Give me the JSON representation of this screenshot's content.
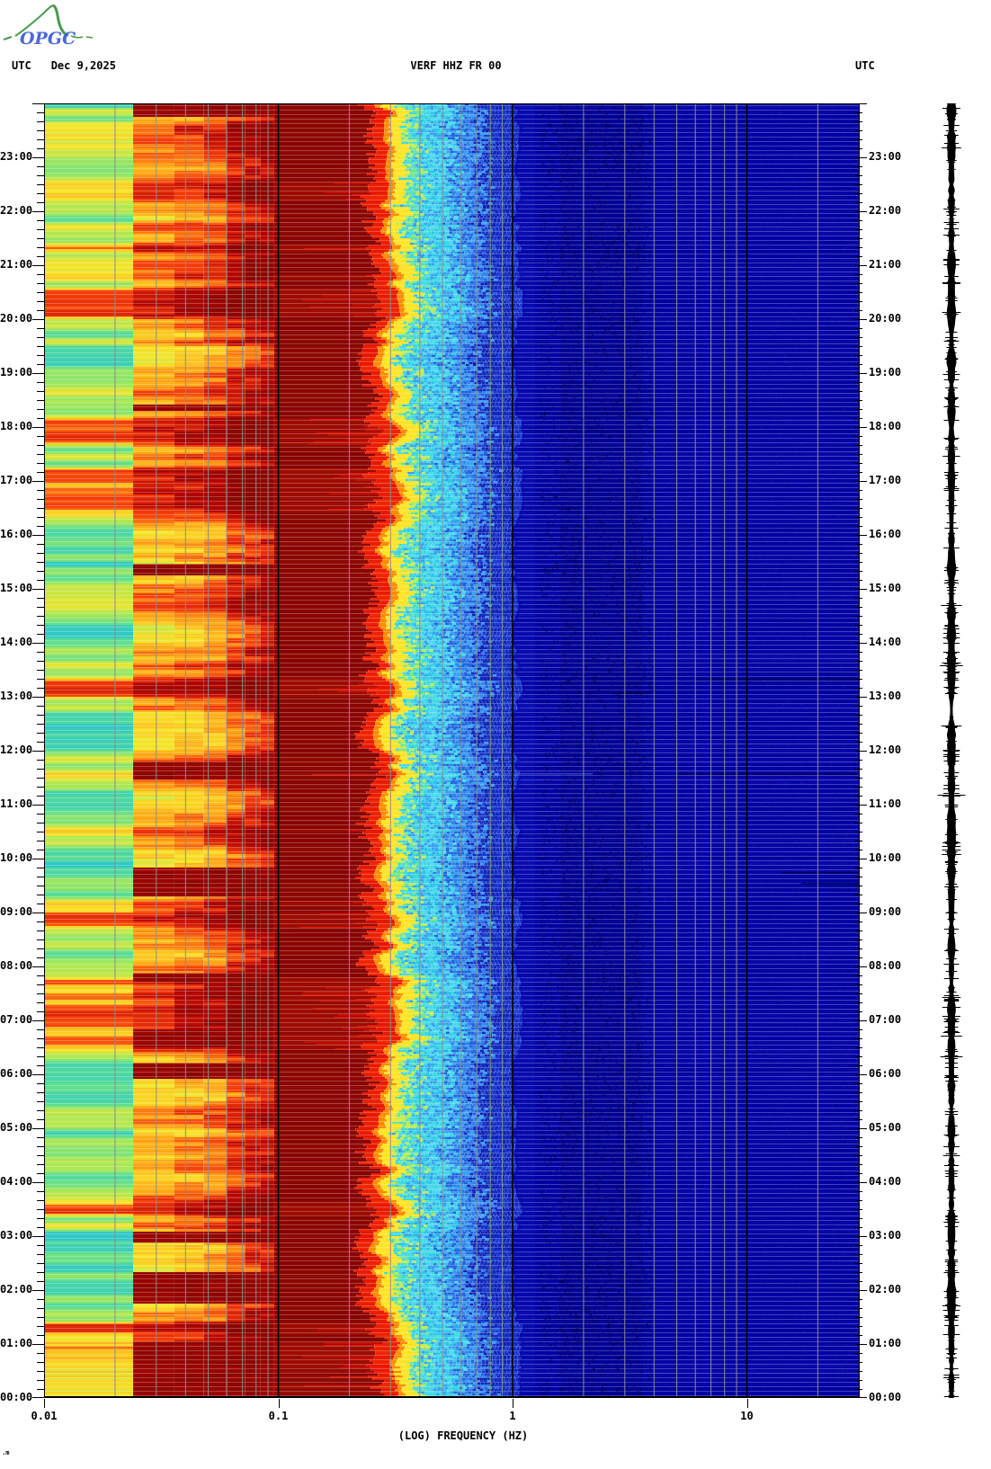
{
  "header": {
    "logo_text": "OPGC",
    "left_utc": "UTC",
    "date": "Dec 9,2025",
    "title": "VERF HHZ FR 00",
    "right_utc": "UTC"
  },
  "axes": {
    "x_label": "(LOG) FREQUENCY (HZ)",
    "x_ticks": [
      {
        "value": 0.01,
        "label": "0.01"
      },
      {
        "value": 0.1,
        "label": "0.1"
      },
      {
        "value": 1,
        "label": "1"
      },
      {
        "value": 10,
        "label": "10"
      }
    ],
    "freq_min_hz": 0.01,
    "freq_max_hz": 30,
    "time_span_hours": 24,
    "minor_tick_minutes": 10,
    "y_hour_labels": [
      "00:00",
      "01:00",
      "02:00",
      "03:00",
      "04:00",
      "05:00",
      "06:00",
      "07:00",
      "08:00",
      "09:00",
      "10:00",
      "11:00",
      "12:00",
      "13:00",
      "14:00",
      "15:00",
      "16:00",
      "17:00",
      "18:00",
      "19:00",
      "20:00",
      "21:00",
      "22:00",
      "23:00"
    ]
  },
  "corner_mark": ".m",
  "chart_data": {
    "type": "heatmap",
    "subtype": "24h seismic spectrogram, log frequency axis",
    "title": "VERF HHZ FR 00",
    "station": "VERF",
    "channel": "HHZ",
    "network": "FR",
    "location": "00",
    "date_utc": "Dec 9,2025",
    "xlabel": "(LOG) FREQUENCY (HZ)",
    "x_scale": "log",
    "x_range_hz": [
      0.01,
      30
    ],
    "y_axis": "Time UTC, 00:00 at bottom to 24:00 at top, hourly labels, 10-minute minor ticks",
    "colormap": "jet (navy blue = low power, dark red = saturated high power)",
    "fft_bin_edges_hz": [
      0.01,
      0.024,
      0.036,
      0.048,
      0.06,
      0.072,
      0.084,
      0.096
    ],
    "features": {
      "saturation_band_hz": [
        0.096,
        0.28
      ],
      "microseism_edge_hz": 0.29,
      "cyan_band_hz": [
        0.4,
        0.6
      ],
      "navy_above_hz": 1.0,
      "dark_mottling_hz": [
        1.3,
        4.0
      ],
      "saturated_full_hours": "00:00-01:00 (0.024-0.28 Hz solid dark red)"
    },
    "frequency_bands": [
      {
        "range_hz": [
          0.01,
          0.024
        ],
        "power_level_norm": 0.35,
        "appearance": "banded green/cyan/yellow rows with orange-red gusts"
      },
      {
        "range_hz": [
          0.024,
          0.096
        ],
        "power_level_norm": 0.62,
        "appearance": "yellow-orange blocks with red bursts, dark red when saturated"
      },
      {
        "range_hz": [
          0.096,
          0.28
        ],
        "power_level_norm": 1.0,
        "appearance": "solid dark red (clipped maximum) with thin bright red streaks"
      },
      {
        "range_hz": [
          0.28,
          0.4
        ],
        "power_level_norm": 0.7,
        "appearance": "jagged red-orange-yellow microseism edge"
      },
      {
        "range_hz": [
          0.4,
          0.6
        ],
        "power_level_norm": 0.35,
        "appearance": "speckled cyan / light blue"
      },
      {
        "range_hz": [
          0.6,
          1.0
        ],
        "power_level_norm": 0.18,
        "appearance": "blue fading to navy"
      },
      {
        "range_hz": [
          1.0,
          30
        ],
        "power_level_norm": 0.05,
        "appearance": "uniform navy with darker mottling 1.3-4 Hz"
      }
    ],
    "events": [
      {
        "time": "13:20",
        "range_hz": [
          6,
          30
        ],
        "type": "dark",
        "note": "faint dark streak"
      },
      {
        "time": "13:05",
        "range_hz": [
          2.8,
          3.8
        ],
        "type": "dark",
        "note": "dark dot"
      },
      {
        "time": "11:35",
        "range_hz": [
          0.9,
          2.2
        ],
        "type": "light",
        "note": "faint light-blue streak"
      },
      {
        "time": "11:35",
        "range_hz": [
          5,
          30
        ],
        "type": "dark",
        "note": "dark streak"
      },
      {
        "time": "09:45",
        "range_hz": [
          14,
          30
        ],
        "type": "dark",
        "note": "dark streak"
      },
      {
        "time": "09:33",
        "range_hz": [
          17,
          30
        ],
        "type": "dark",
        "note": "faint dark streak"
      }
    ],
    "side_panel": "vertical black seismogram trace, continuous noise with variable amplitude, spans full 24 h"
  },
  "colors": {
    "grid": "#8c8c8c",
    "axis": "#000000",
    "maroon": "#8b0600",
    "maroon_hot": "#9d0b00",
    "red": "#e51400",
    "orange": "#ff8c00",
    "yellow": "#ffe427",
    "navy": "#0303a4",
    "navy_dark": "#000078",
    "royal": "#1129bd",
    "blue": "#1e50e0",
    "sky": "#38a0ee",
    "cyan": "#3cd8e0",
    "green": "#72e48c",
    "ygreen": "#c0ec4c",
    "light_streak": "#3a56c8",
    "waveform": "#000000",
    "logo_green": "#4a9a50",
    "logo_blue": "#3b5bd6",
    "ramp": [
      [
        0.0,
        "#2ec8c8"
      ],
      [
        0.1,
        "#5ade96"
      ],
      [
        0.25,
        "#a8e858"
      ],
      [
        0.42,
        "#f8e428"
      ],
      [
        0.58,
        "#ffa214"
      ],
      [
        0.72,
        "#f53c0a"
      ],
      [
        0.85,
        "#b80500"
      ],
      [
        1.0,
        "#8b0600"
      ]
    ]
  }
}
